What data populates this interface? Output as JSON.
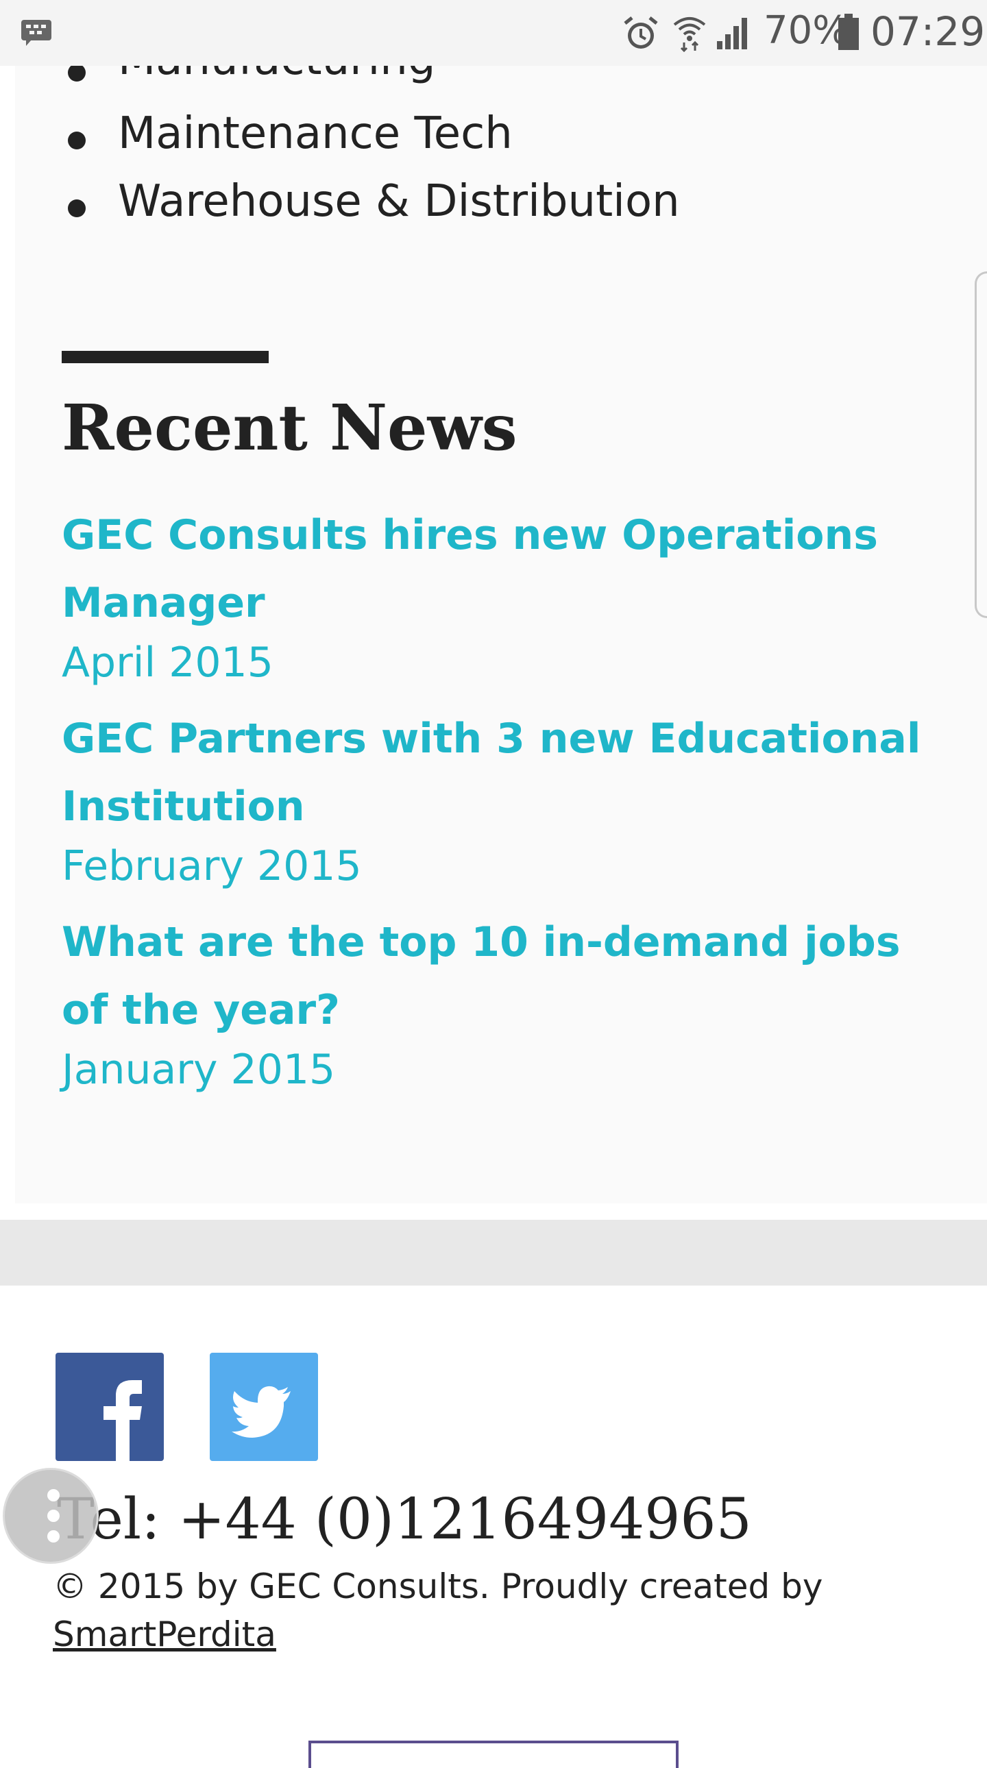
{
  "status_bar": {
    "battery_percent": "70%",
    "time": "07:29",
    "icons": [
      "bbm-icon",
      "alarm-icon",
      "wifi-icon",
      "signal-icon",
      "battery-icon"
    ]
  },
  "jobs": [
    "Manufacturing",
    "Maintenance Tech",
    "Warehouse & Distribution"
  ],
  "news": {
    "heading": "Recent News",
    "items": [
      {
        "title": "GEC Consults hires new Operations Manager",
        "date": "April 2015"
      },
      {
        "title": "GEC Partners with 3 new Educational Institution",
        "date": "February 2015"
      },
      {
        "title": "What are the top 10 in-demand jobs of the year?",
        "date": "January 2015"
      }
    ]
  },
  "footer": {
    "social": [
      "facebook-icon",
      "twitter-icon"
    ],
    "tel": "Tel: +44 (0)1216494965",
    "copyright": "© 2015 by GEC Consults. Proudly created by",
    "credit_link": "SmartPerdita"
  },
  "colors": {
    "accent": "#1fb6c9",
    "text": "#222222",
    "facebook": "#3b5998",
    "twitter": "#55acee"
  }
}
